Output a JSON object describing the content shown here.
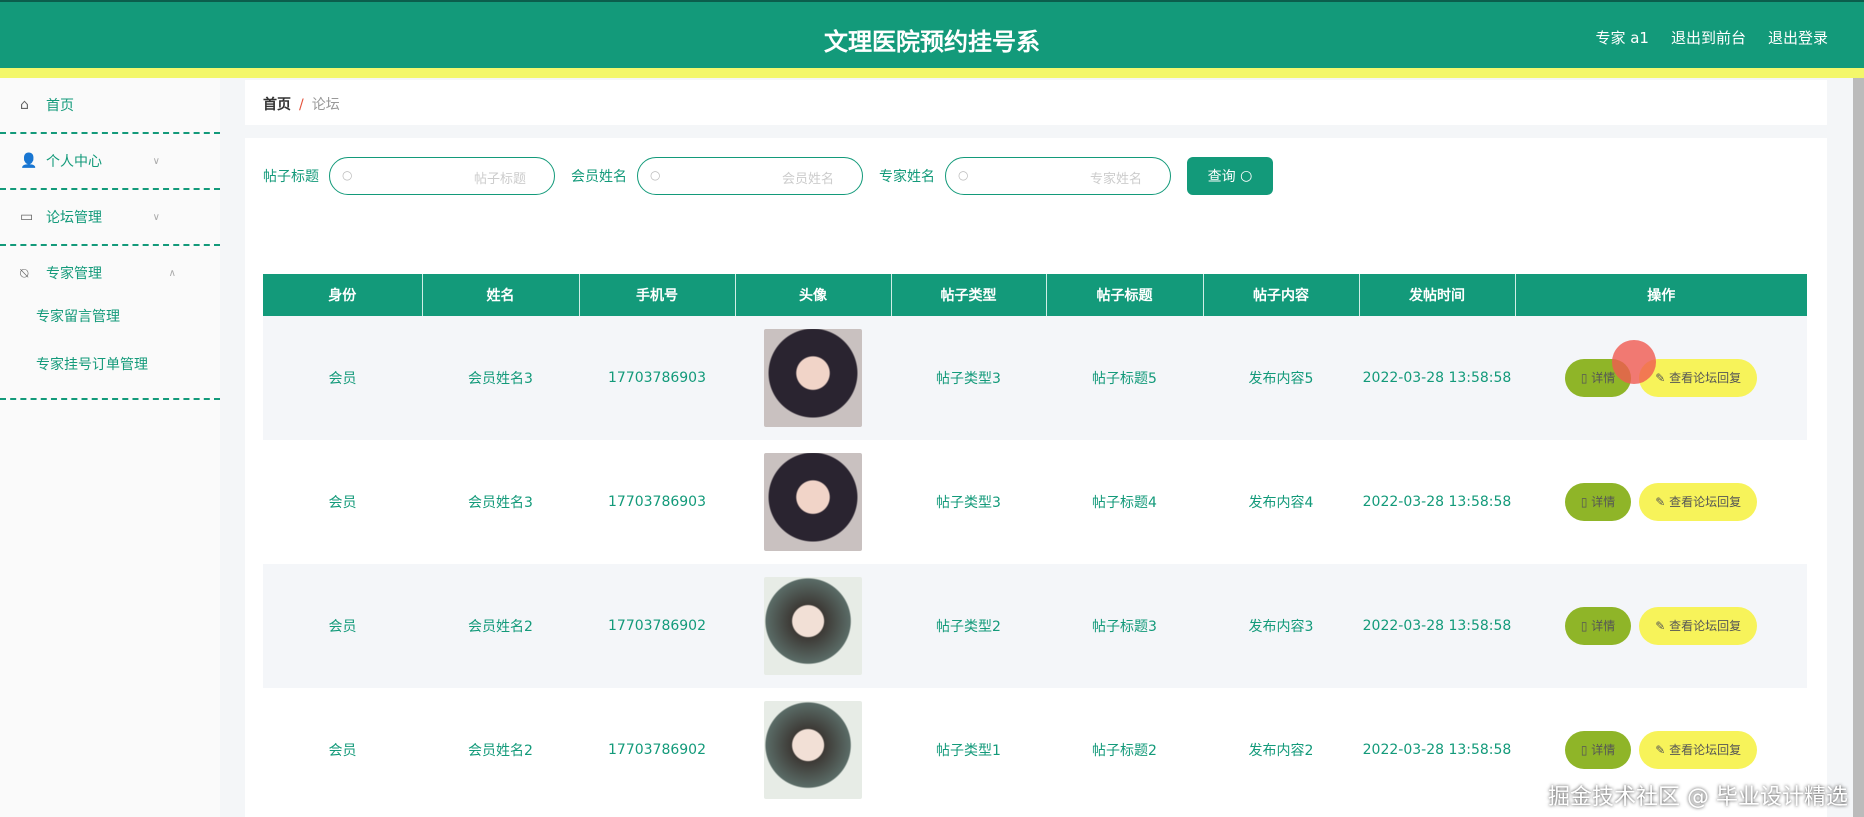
{
  "header": {
    "title": "文理医院预约挂号系",
    "user": "专家 a1",
    "to_front": "退出到前台",
    "logout": "退出登录"
  },
  "sidebar": {
    "items": [
      {
        "label": "首页",
        "icon": "home-icon"
      },
      {
        "label": "个人中心",
        "icon": "user-icon"
      },
      {
        "label": "论坛管理",
        "icon": "message-icon"
      },
      {
        "label": "专家管理",
        "icon": "bell-off-icon"
      }
    ],
    "sub_items": [
      "专家留言管理",
      "专家挂号订单管理"
    ]
  },
  "breadcrumb": {
    "home": "首页",
    "sep": "/",
    "current": "论坛"
  },
  "search": {
    "fields": [
      {
        "label": "帖子标题",
        "placeholder": "帖子标题"
      },
      {
        "label": "会员姓名",
        "placeholder": "会员姓名"
      },
      {
        "label": "专家姓名",
        "placeholder": "专家姓名"
      }
    ],
    "button": "查询"
  },
  "table": {
    "headers": [
      "身份",
      "姓名",
      "手机号",
      "头像",
      "帖子类型",
      "帖子标题",
      "帖子内容",
      "发帖时间",
      "操作"
    ],
    "rows": [
      {
        "role": "会员",
        "name": "会员姓名3",
        "phone": "17703786903",
        "type": "帖子类型3",
        "title": "帖子标题5",
        "content": "发布内容5",
        "time": "2022-03-28 13:58:58"
      },
      {
        "role": "会员",
        "name": "会员姓名3",
        "phone": "17703786903",
        "type": "帖子类型3",
        "title": "帖子标题4",
        "content": "发布内容4",
        "time": "2022-03-28 13:58:58"
      },
      {
        "role": "会员",
        "name": "会员姓名2",
        "phone": "17703786902",
        "type": "帖子类型2",
        "title": "帖子标题3",
        "content": "发布内容3",
        "time": "2022-03-28 13:58:58"
      },
      {
        "role": "会员",
        "name": "会员姓名2",
        "phone": "17703786902",
        "type": "帖子类型1",
        "title": "帖子标题2",
        "content": "发布内容2",
        "time": "2022-03-28 13:58:58"
      }
    ],
    "detail_btn": "详情",
    "reply_btn": "查看论坛回复"
  },
  "watermark": "掘金技术社区 @ 毕业设计精选"
}
